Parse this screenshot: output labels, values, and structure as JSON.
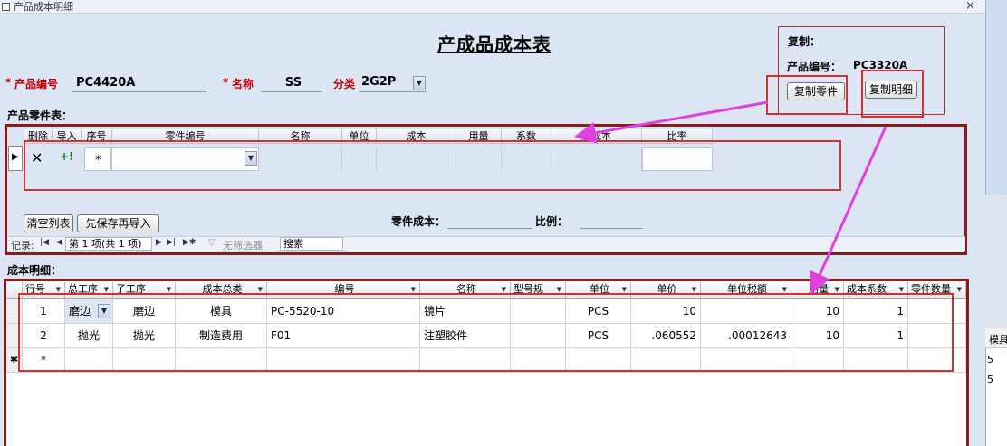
{
  "window": {
    "title": "产品成本明细",
    "close_glyph": "×"
  },
  "page_title": "产成品成本表",
  "header_fields": {
    "product_no_label": "产品编号",
    "product_no_value": "PC4420A",
    "name_label": "名称",
    "name_value": "SS",
    "category_label": "分类",
    "category_value": "2G2P",
    "required_mark": "*"
  },
  "copy_panel": {
    "title": "复制：",
    "product_no_label": "产品编号：",
    "product_no_value": "PC3320A",
    "copy_parts_button": "复制零件",
    "copy_details_button": "复制明细"
  },
  "parts_section": {
    "label": "产品零件表：",
    "columns": [
      "删除",
      "导入",
      "序号",
      "零件编号",
      "名称",
      "单位",
      "成本",
      "用量",
      "系数",
      "总成本",
      "比率"
    ],
    "new_row_mark": "*",
    "delete_glyph": "✕",
    "import_glyph": "+!",
    "clear_button": "清空列表",
    "save_import_button": "先保存再导入",
    "part_cost_label": "零件成本：",
    "ratio_label": "比例："
  },
  "navigator": {
    "records_label": "记录:",
    "position": "第 1 项(共 1 项)",
    "no_filter": "无筛选器",
    "search_placeholder": "搜索"
  },
  "detail_section": {
    "label": "成本明细：",
    "columns": [
      "行号",
      "总工序",
      "子工序",
      "成本总类",
      "编号",
      "名称",
      "型号规",
      "单位",
      "单价",
      "单位税额",
      "用量",
      "成本系数",
      "零件数量"
    ],
    "rows": [
      {
        "row_no": "1",
        "main_process": "磨边",
        "sub_process": "磨边",
        "cost_type": "模具",
        "code": "PC-5520-10",
        "name": "镜片",
        "model": "",
        "unit": "PCS",
        "unit_price": "10",
        "unit_tax": "",
        "qty": "10",
        "cost_factor": "1",
        "part_qty": ""
      },
      {
        "row_no": "2",
        "main_process": "抛光",
        "sub_process": "抛光",
        "cost_type": "制造费用",
        "code": "F01",
        "name": "注塑胶件",
        "model": "",
        "unit": "PCS",
        "unit_price": ".060552",
        "unit_tax": ".00012643",
        "qty": "10",
        "cost_factor": "1",
        "part_qty": ""
      }
    ],
    "new_row_selector": "✱",
    "new_row_mark": "*"
  },
  "side_panel": {
    "header": "模具",
    "values": [
      "5",
      "5"
    ]
  },
  "colors": {
    "arrow": "#e040e0",
    "annotation_red": "#d43030",
    "frame_dark_red": "#8b1a1a"
  }
}
